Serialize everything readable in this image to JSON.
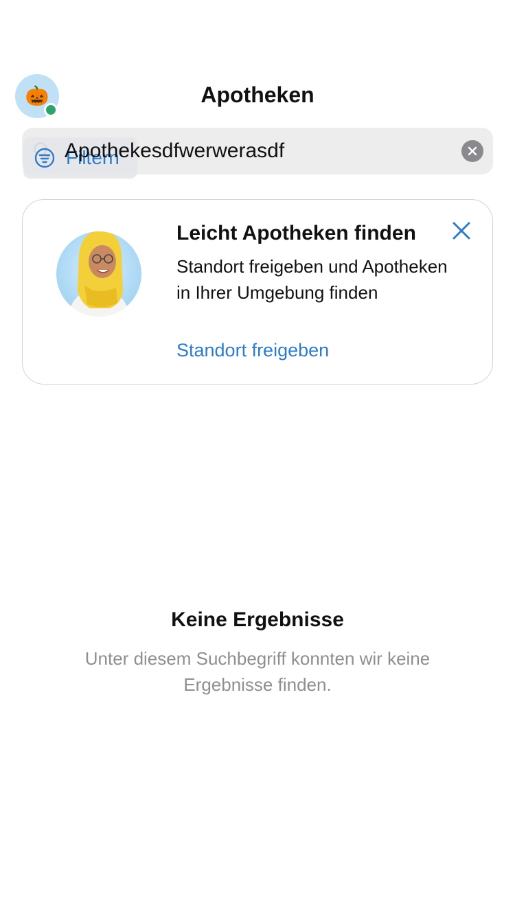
{
  "header": {
    "title": "Apotheken",
    "avatar_emoji": "🎃",
    "avatar_status_color": "#2fa36b"
  },
  "search": {
    "value": "Apothekesdfwerwerasdf",
    "placeholder": "",
    "search_icon": "search-icon",
    "clear_icon": "clear-icon"
  },
  "filter": {
    "label": "Filtern",
    "icon": "filter-icon"
  },
  "location_card": {
    "title": "Leicht Apotheken finden",
    "body": "Standort freigeben und Apotheken in Ihrer Umgebung finden",
    "link": "Standort freigeben",
    "close_icon": "close-icon",
    "illustration": "pharmacist-avatar"
  },
  "empty_state": {
    "title": "Keine Ergebnisse",
    "text": "Unter diesem Suchbegriff konnten wir keine Ergebnisse finden."
  },
  "colors": {
    "accent": "#2e7bcc",
    "search_bg": "#ededee",
    "secondary_text": "#8e8e93"
  }
}
